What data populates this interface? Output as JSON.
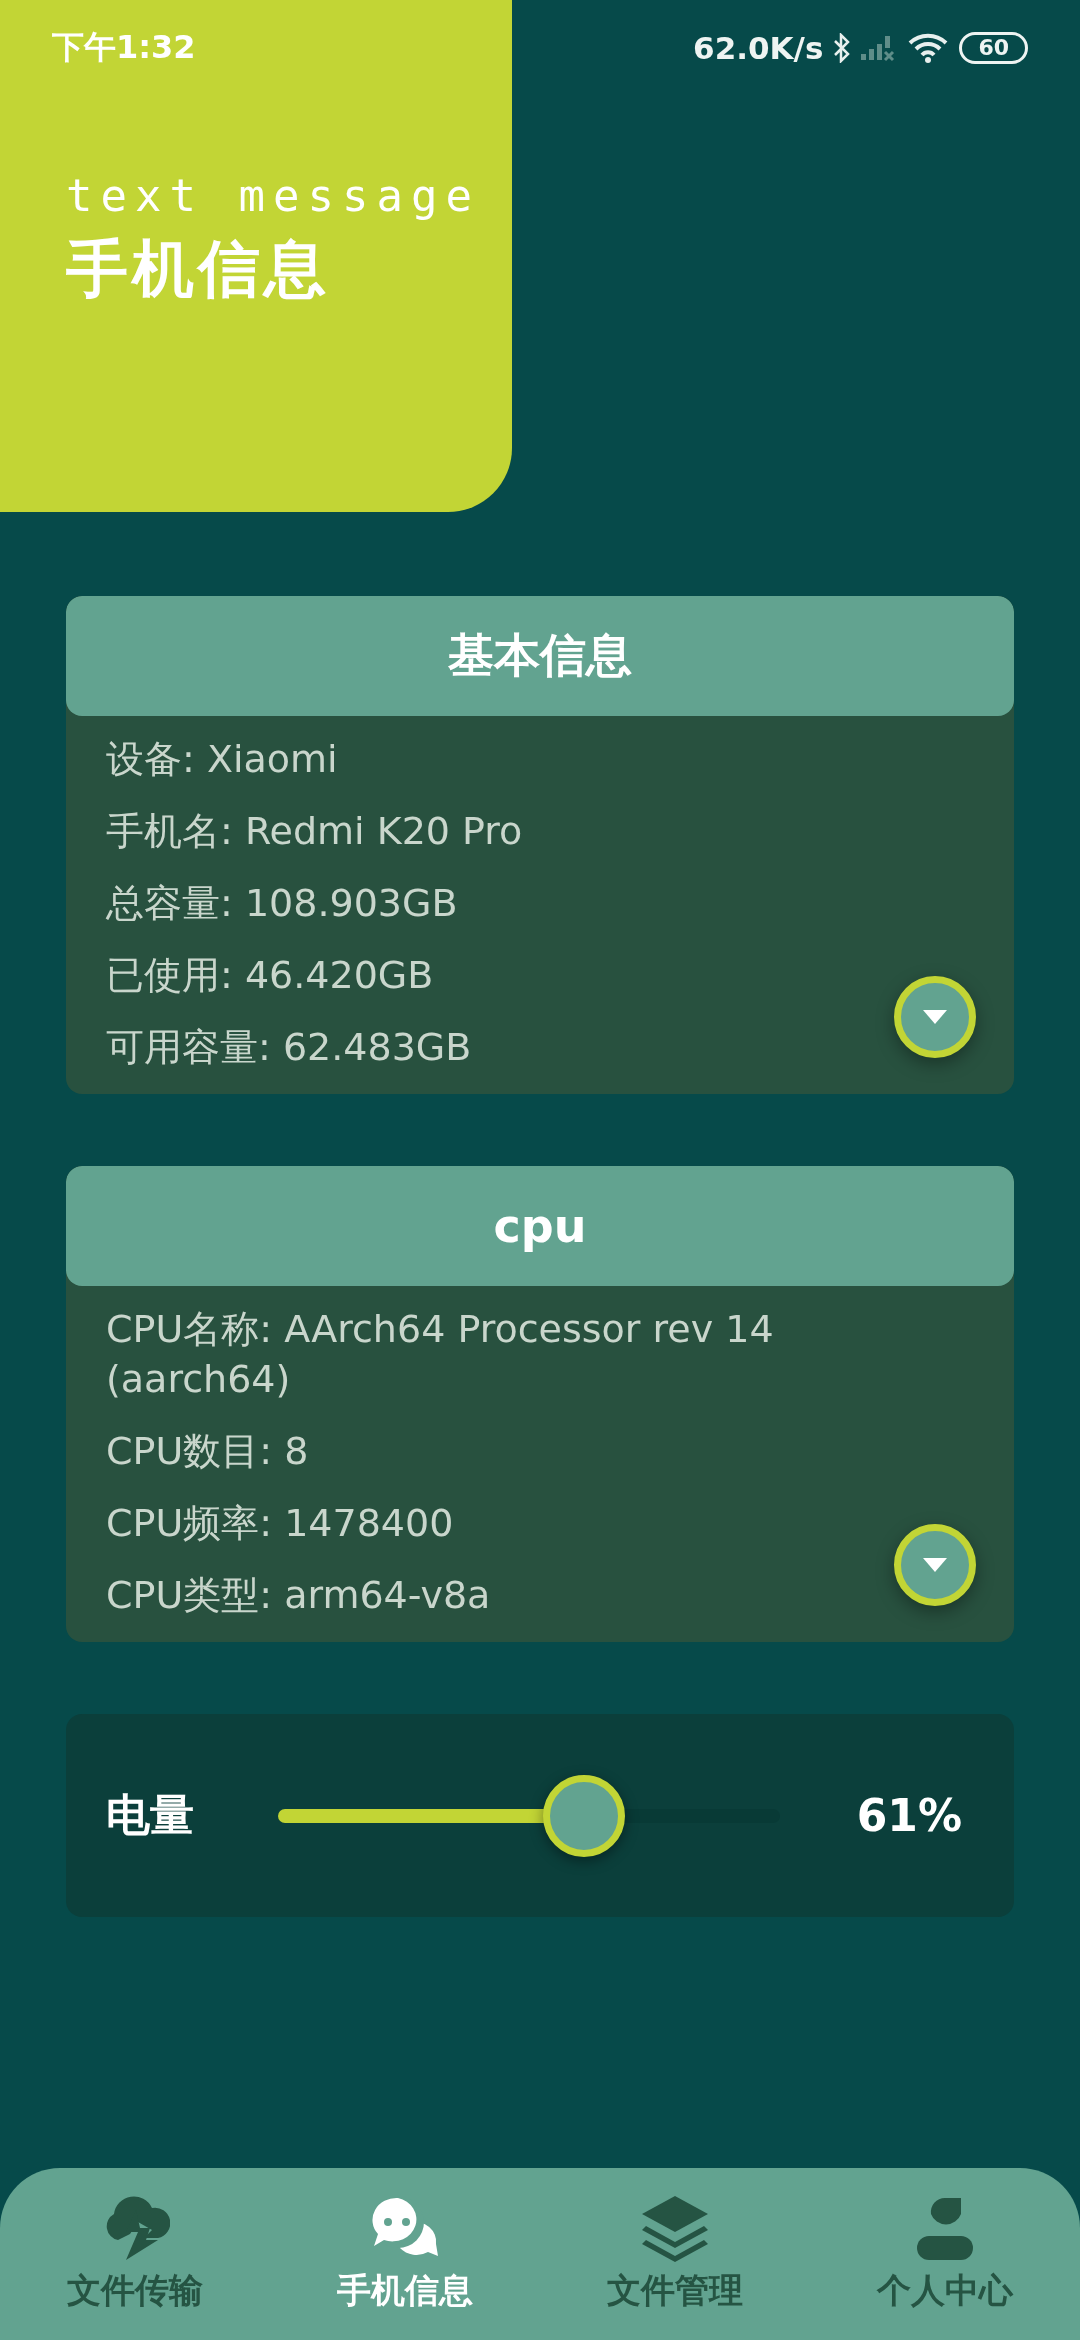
{
  "status_bar": {
    "time": "下午1:32",
    "net_speed": "62.0K/s",
    "battery": "60"
  },
  "header": {
    "subtitle": "text message",
    "title": "手机信息"
  },
  "cards": [
    {
      "title": "基本信息",
      "lines": [
        "设备: Xiaomi",
        "手机名: Redmi K20 Pro",
        "总容量: 108.903GB",
        "已使用: 46.420GB",
        "可用容量: 62.483GB"
      ]
    },
    {
      "title": "cpu",
      "lines": [
        "CPU名称: AArch64 Processor rev 14 (aarch64)",
        "CPU数目: 8",
        "CPU频率: 1478400",
        "CPU类型: arm64-v8a"
      ]
    }
  ],
  "battery": {
    "label": "电量",
    "level": 0.61,
    "reading": "61%"
  },
  "nav": [
    {
      "kind": "cloud",
      "label": "文件传输",
      "selected": false
    },
    {
      "kind": "chat",
      "label": "手机信息",
      "selected": true
    },
    {
      "kind": "layers",
      "label": "文件管理",
      "selected": false
    },
    {
      "kind": "person",
      "label": "个人中心",
      "selected": false
    }
  ]
}
